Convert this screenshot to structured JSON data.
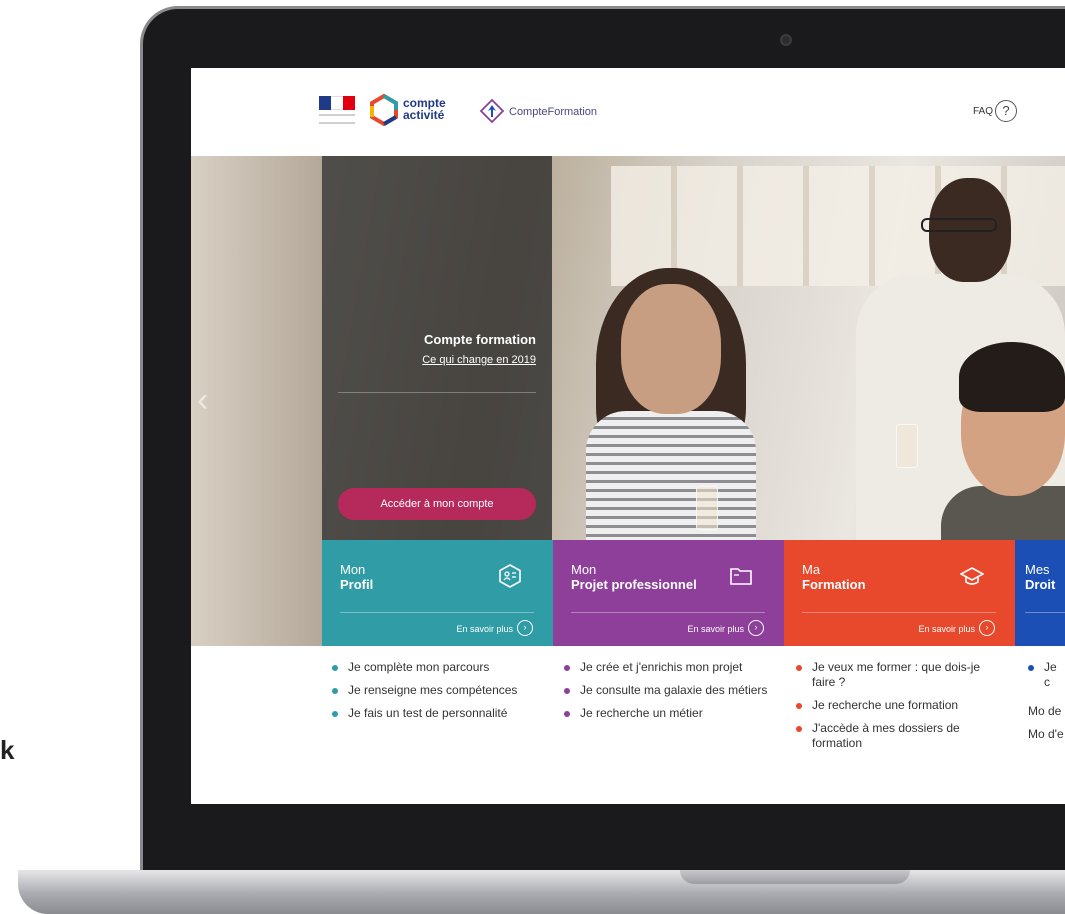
{
  "header": {
    "logo_compte_activite": "compte activité",
    "logo_compte_formation": "CompteFormation",
    "faq_label": "FAQ",
    "faq_icon_glyph": "?"
  },
  "hero": {
    "prev_glyph": "‹",
    "title": "Compte formation",
    "link": "Ce qui change en 2019",
    "button": "Accéder à mon compte"
  },
  "tiles": [
    {
      "small": "Mon",
      "big": "Profil",
      "more": "En savoir plus",
      "color": "#2f9ca6",
      "icon": "profile-card-icon"
    },
    {
      "small": "Mon",
      "big": "Projet professionnel",
      "more": "En savoir plus",
      "color": "#8d3f9a",
      "icon": "folder-icon"
    },
    {
      "small": "Ma",
      "big": "Formation",
      "more": "En savoir plus",
      "color": "#e8482c",
      "icon": "graduation-cap-icon"
    },
    {
      "small": "Mes",
      "big": "Droit",
      "color": "#1c4fb5"
    }
  ],
  "lists": {
    "profil": [
      "Je complète mon parcours",
      "Je renseigne mes compétences",
      "Je fais un test de personnalité"
    ],
    "projet": [
      "Je crée et j'enrichis mon projet",
      "Je consulte ma galaxie des métiers",
      "Je recherche un métier"
    ],
    "formation": [
      "Je veux me former : que dois-je faire ?",
      "Je recherche une formation",
      "J'accède à mes dossiers de formation"
    ],
    "droits_item": "Je c",
    "droits_plain": [
      "Mo de",
      "Mo d'e"
    ]
  },
  "side_char": "k",
  "colors": {
    "accent_button": "#b52a5a",
    "profil": "#2f9ca6",
    "projet": "#8d3f9a",
    "formation": "#e8482c",
    "droits": "#1c4fb5"
  }
}
